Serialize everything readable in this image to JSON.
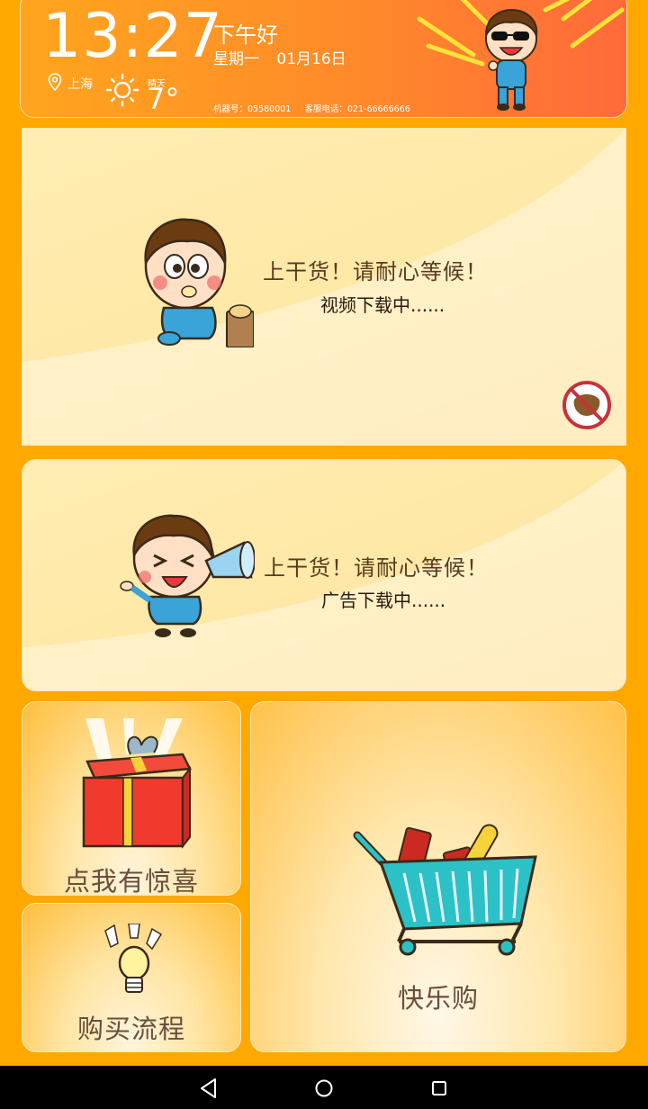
{
  "header": {
    "time": "13:27",
    "greeting": "下午好",
    "weekday": "星期一",
    "date": "01月16日",
    "city": "上海",
    "weather": "晴天",
    "temperature": "7°",
    "machine_no": "机器号：05580001",
    "service_phone": "客服电话：021-66666666"
  },
  "video_card": {
    "title": "上干货！请耐心等候！",
    "subtitle": "视频下载中......",
    "mute_icon": "no-sound-icon"
  },
  "ad_card": {
    "title": "上干货！请耐心等候！",
    "subtitle": "广告下载中......"
  },
  "tiles": {
    "gift_label": "点我有惊喜",
    "flow_label": "购买流程",
    "shop_label": "快乐购"
  },
  "navbar": {
    "back_icon": "back-triangle-icon",
    "home_icon": "home-circle-icon",
    "recents_icon": "recents-square-icon"
  },
  "colors": {
    "background": "#FFA800",
    "header_start": "#ffa51e",
    "header_end": "#ff6a3a",
    "text_brown": "#5a3a1e"
  }
}
